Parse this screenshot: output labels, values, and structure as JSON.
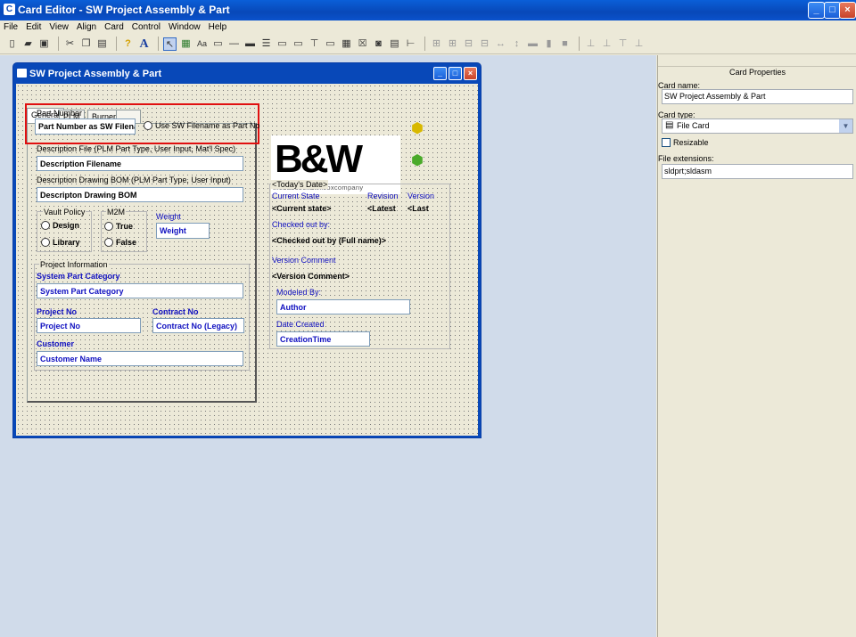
{
  "app": {
    "title": "Card Editor - SW Project Assembly & Part"
  },
  "menu": [
    "File",
    "Edit",
    "View",
    "Align",
    "Card",
    "Control",
    "Window",
    "Help"
  ],
  "card_window": {
    "title": "SW Project Assembly & Part"
  },
  "tabs": [
    "General",
    "PLM",
    "Burner",
    ""
  ],
  "form": {
    "part_number_label": "Part Number",
    "part_number_value": "Part Number as SW Filename",
    "use_filename_label": "Use SW Filename as Part No",
    "desc_file_label": "Description File (PLM Part Type, User Input, Mat'l Spec)",
    "desc_file_value": "Description Filename",
    "desc_bom_label": "Description Drawing BOM (PLM Part Type, User Input)",
    "desc_bom_value": "Descripton Drawing BOM",
    "vault_policy_label": "Vault Policy",
    "design_label": "Design",
    "library_label": "Library",
    "m2m_label": "M2M",
    "true_label": "True",
    "false_label": "False",
    "weight_label": "Weight",
    "weight_value": "Weight",
    "project_info_label": "Project Information",
    "system_part_category_label": "System Part Category",
    "system_part_category_value": "System Part Category",
    "project_no_label": "Project No",
    "project_no_value": "Project No",
    "contract_no_label": "Contract No",
    "contract_no_value": "Contract No (Legacy)",
    "customer_label": "Customer",
    "customer_value": "Customer Name",
    "logo_text": "B&W",
    "logo_sub": "thebabcock&wilcoxcompany",
    "todays_date": "<Today's Date>",
    "current_state_label": "Current State",
    "current_state_value": "<Current state>",
    "revision_label": "Revision",
    "revision_value": "<Latest",
    "version_label": "Version",
    "version_value": "<Last",
    "checked_out_label": "Checked out by:",
    "checked_out_value": "<Checked out by (Full name)>",
    "version_comment_label": "Version Comment",
    "version_comment_value": "<Version Comment>",
    "modeled_by_label": "Modeled By:",
    "modeled_by_value": "Author",
    "date_created_label": "Date Created",
    "date_created_value": "CreationTime"
  },
  "properties": {
    "header": "Card Properties",
    "card_name_label": "Card name:",
    "card_name_value": "SW Project Assembly & Part",
    "card_type_label": "Card type:",
    "card_type_value": "File Card",
    "resizable_label": "Resizable",
    "file_ext_label": "File extensions:",
    "file_ext_value": "sldprt;sldasm"
  },
  "colors": {
    "titlebar": "#0848b8",
    "field_text": "#1010c0",
    "highlight": "#e01010"
  }
}
